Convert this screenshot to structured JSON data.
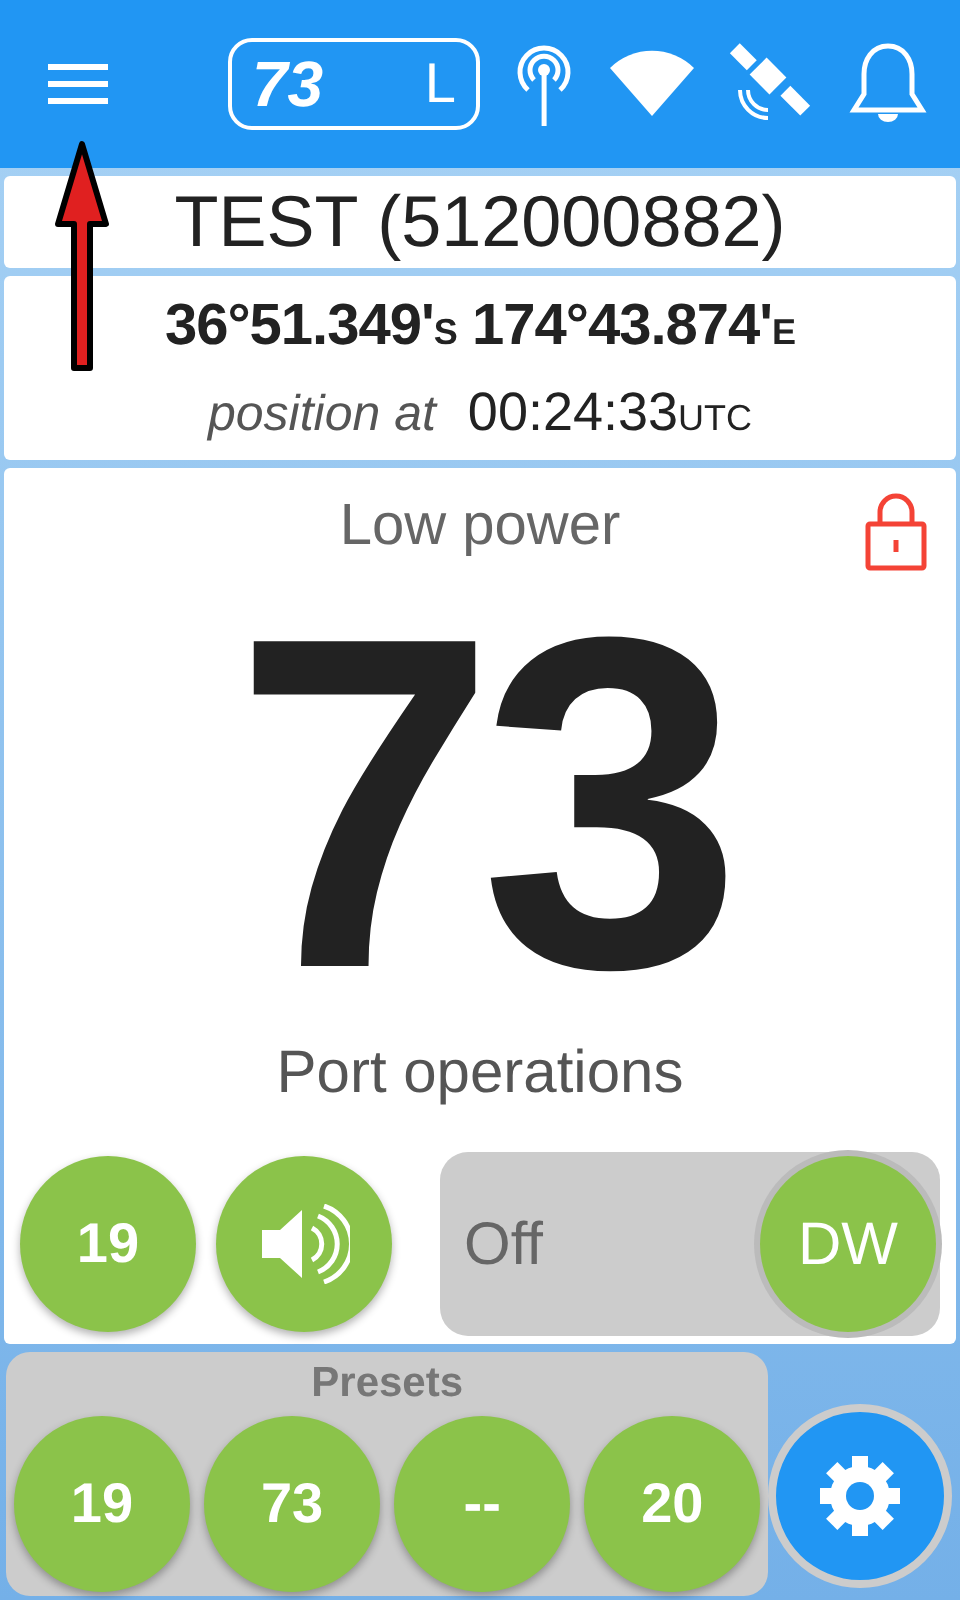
{
  "header": {
    "channel": "73",
    "power": "L"
  },
  "vessel": {
    "name": "TEST (512000882)"
  },
  "position": {
    "lat": "36°51.349'",
    "lat_hemi": "S",
    "lon": "174°43.874'",
    "lon_hemi": "E",
    "label": "position at",
    "time": "00:24:33",
    "tz": "UTC"
  },
  "main": {
    "power_label": "Low power",
    "channel": "73",
    "channel_name": "Port operations",
    "locked": true
  },
  "controls": {
    "channel_button": "19",
    "toggle": {
      "label": "Off",
      "button": "DW"
    }
  },
  "presets": {
    "title": "Presets",
    "items": [
      "19",
      "73",
      "--",
      "20"
    ]
  }
}
